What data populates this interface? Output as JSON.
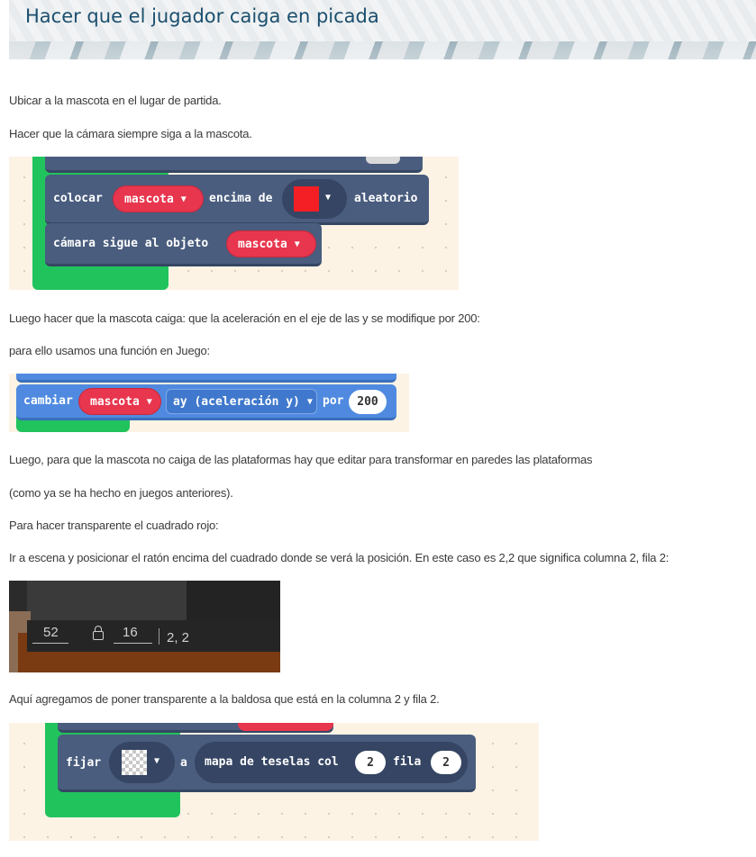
{
  "title": "Hacer que el jugador caiga en picada",
  "paragraphs": {
    "p1": "Ubicar a la mascota en el lugar de partida.",
    "p2": "Hacer que la cámara siempre siga a la mascota.",
    "p3": "Luego hacer que la mascota caiga: que la aceleración en el eje de las y se modifique por 200:",
    "p4": "para ello usamos una función en Juego:",
    "p5": "Luego, para que la mascota no caiga de las plataformas hay que editar para transformar en paredes las plataformas",
    "p6": "(como ya se ha hecho en juegos anteriores).",
    "p7": "Para hacer transparente el cuadrado rojo:",
    "p8": "Ir a escena y posicionar el ratón encima del cuadrado donde se verá  la posición. En este caso es 2,2 que significa columna 2, fila 2:",
    "p9": "Aquí agregamos de poner transparente a la baldosa que está en la columna 2 y fila 2."
  },
  "block1": {
    "place_label": "colocar",
    "place_var": "mascota",
    "on_top_label": "encima de",
    "tile_color": "#f31f25",
    "random_label": "aleatorio",
    "camera_label": "cámara sigue al objeto",
    "camera_var": "mascota"
  },
  "block2": {
    "change_label": "cambiar",
    "var": "mascota",
    "property": "ay (aceleración y)",
    "by_label": "por",
    "value": "200"
  },
  "screenshot": {
    "x_value": "52",
    "y_value": "16",
    "position": "2, 2"
  },
  "block3": {
    "set_label": "fijar",
    "to_label": "a",
    "tilemap_label": "mapa de teselas col",
    "col_value": "2",
    "row_label": "fila",
    "row_value": "2"
  },
  "icons": {
    "dropdown": "chevron-down-icon",
    "lock": "lock-icon",
    "transparent_tile": "transparent-tile-icon"
  }
}
